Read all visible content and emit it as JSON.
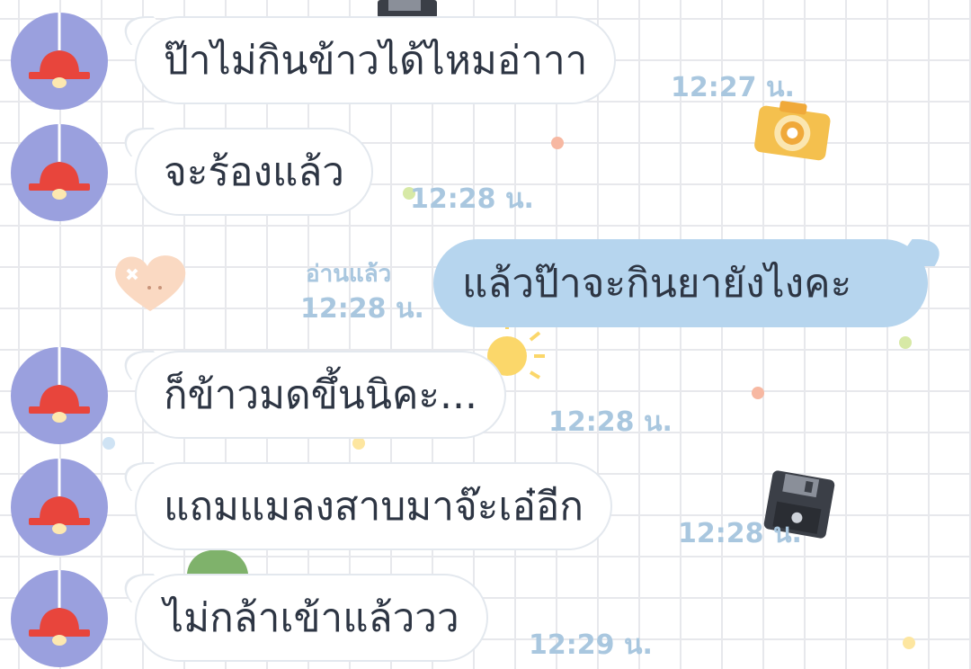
{
  "colors": {
    "background": "#ffffff",
    "grid": "#e7e8ec",
    "incoming_bubble": "#ffffff",
    "outgoing_bubble": "#b6d5ee",
    "timestamp": "#a9c7df",
    "avatar_bg": "#9aa0de",
    "lamp": "#e8453c"
  },
  "messages": [
    {
      "direction": "incoming",
      "text": "ป๊าไม่กินข้าวได้ไหมอ่าาา",
      "time": "12:27 น."
    },
    {
      "direction": "incoming",
      "text": "จะร้องแล้ว",
      "time": "12:28 น."
    },
    {
      "direction": "outgoing",
      "text": "แล้วป๊าจะกินยายังไงคะ",
      "time": "12:28 น.",
      "read": "อ่านแล้ว"
    },
    {
      "direction": "incoming",
      "text": "ก็ข้าวมดขึ้นนิคะ...",
      "time": "12:28 น."
    },
    {
      "direction": "incoming",
      "text": "แถมแมลงสาบมาจ๊ะเอ๋อีก",
      "time": "12:28 น."
    },
    {
      "direction": "incoming",
      "text": "ไม่กล้าเข้าแล้ววว",
      "time": "12:29 น."
    }
  ],
  "avatar_icon": "lamp-icon",
  "background_stickers": [
    "camera-icon",
    "heart-icon",
    "sun-icon",
    "floppy-disk-icon",
    "cactus-icon"
  ]
}
